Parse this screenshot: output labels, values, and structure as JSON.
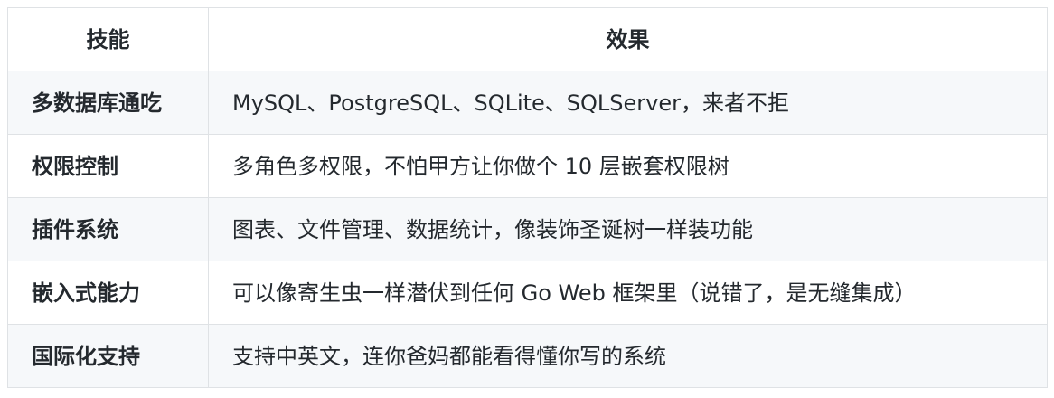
{
  "table": {
    "headers": [
      "技能",
      "效果"
    ],
    "rows": [
      {
        "skill": "多数据库通吃",
        "effect": "MySQL、PostgreSQL、SQLite、SQLServer，来者不拒"
      },
      {
        "skill": "权限控制",
        "effect": "多角色多权限，不怕甲方让你做个 10 层嵌套权限树"
      },
      {
        "skill": "插件系统",
        "effect": "图表、文件管理、数据统计，像装饰圣诞树一样装功能"
      },
      {
        "skill": "嵌入式能力",
        "effect": "可以像寄生虫一样潜伏到任何 Go Web 框架里（说错了，是无缝集成）"
      },
      {
        "skill": "国际化支持",
        "effect": "支持中英文，连你爸妈都能看得懂你写的系统"
      }
    ]
  }
}
